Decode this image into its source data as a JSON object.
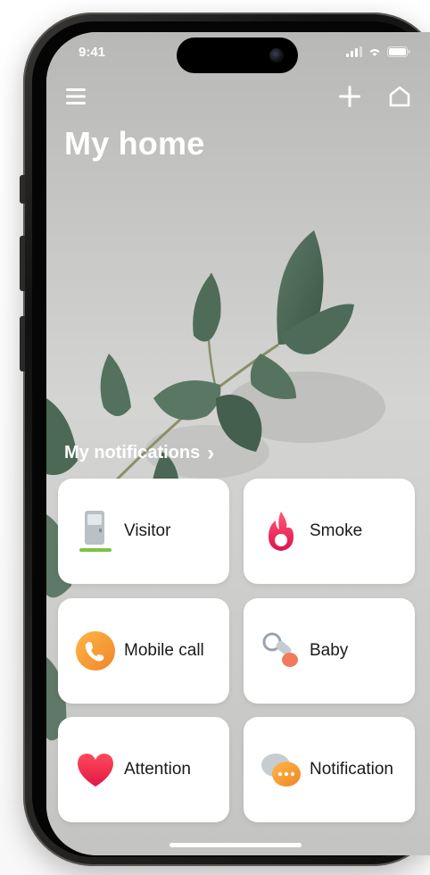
{
  "status_bar": {
    "time": "9:41"
  },
  "header": {
    "title": "My home",
    "icons": {
      "menu": "menu-icon",
      "add": "plus-icon",
      "home": "home-icon"
    }
  },
  "notifications": {
    "heading": "My notifications",
    "chevron": "›",
    "tiles": [
      {
        "label": "Visitor",
        "icon": "door-icon"
      },
      {
        "label": "Smoke",
        "icon": "flame-icon"
      },
      {
        "label": "Mobile call",
        "icon": "phone-icon"
      },
      {
        "label": "Baby",
        "icon": "pacifier-icon"
      },
      {
        "label": "Attention",
        "icon": "heart-icon"
      },
      {
        "label": "Notification",
        "icon": "chat-bubble-icon"
      }
    ]
  },
  "colors": {
    "flame": "#e8225a",
    "call": "#f5a02a",
    "heart": "#e8284a",
    "chat": "#f5a02a",
    "visitor_bar": "#7cc242"
  }
}
